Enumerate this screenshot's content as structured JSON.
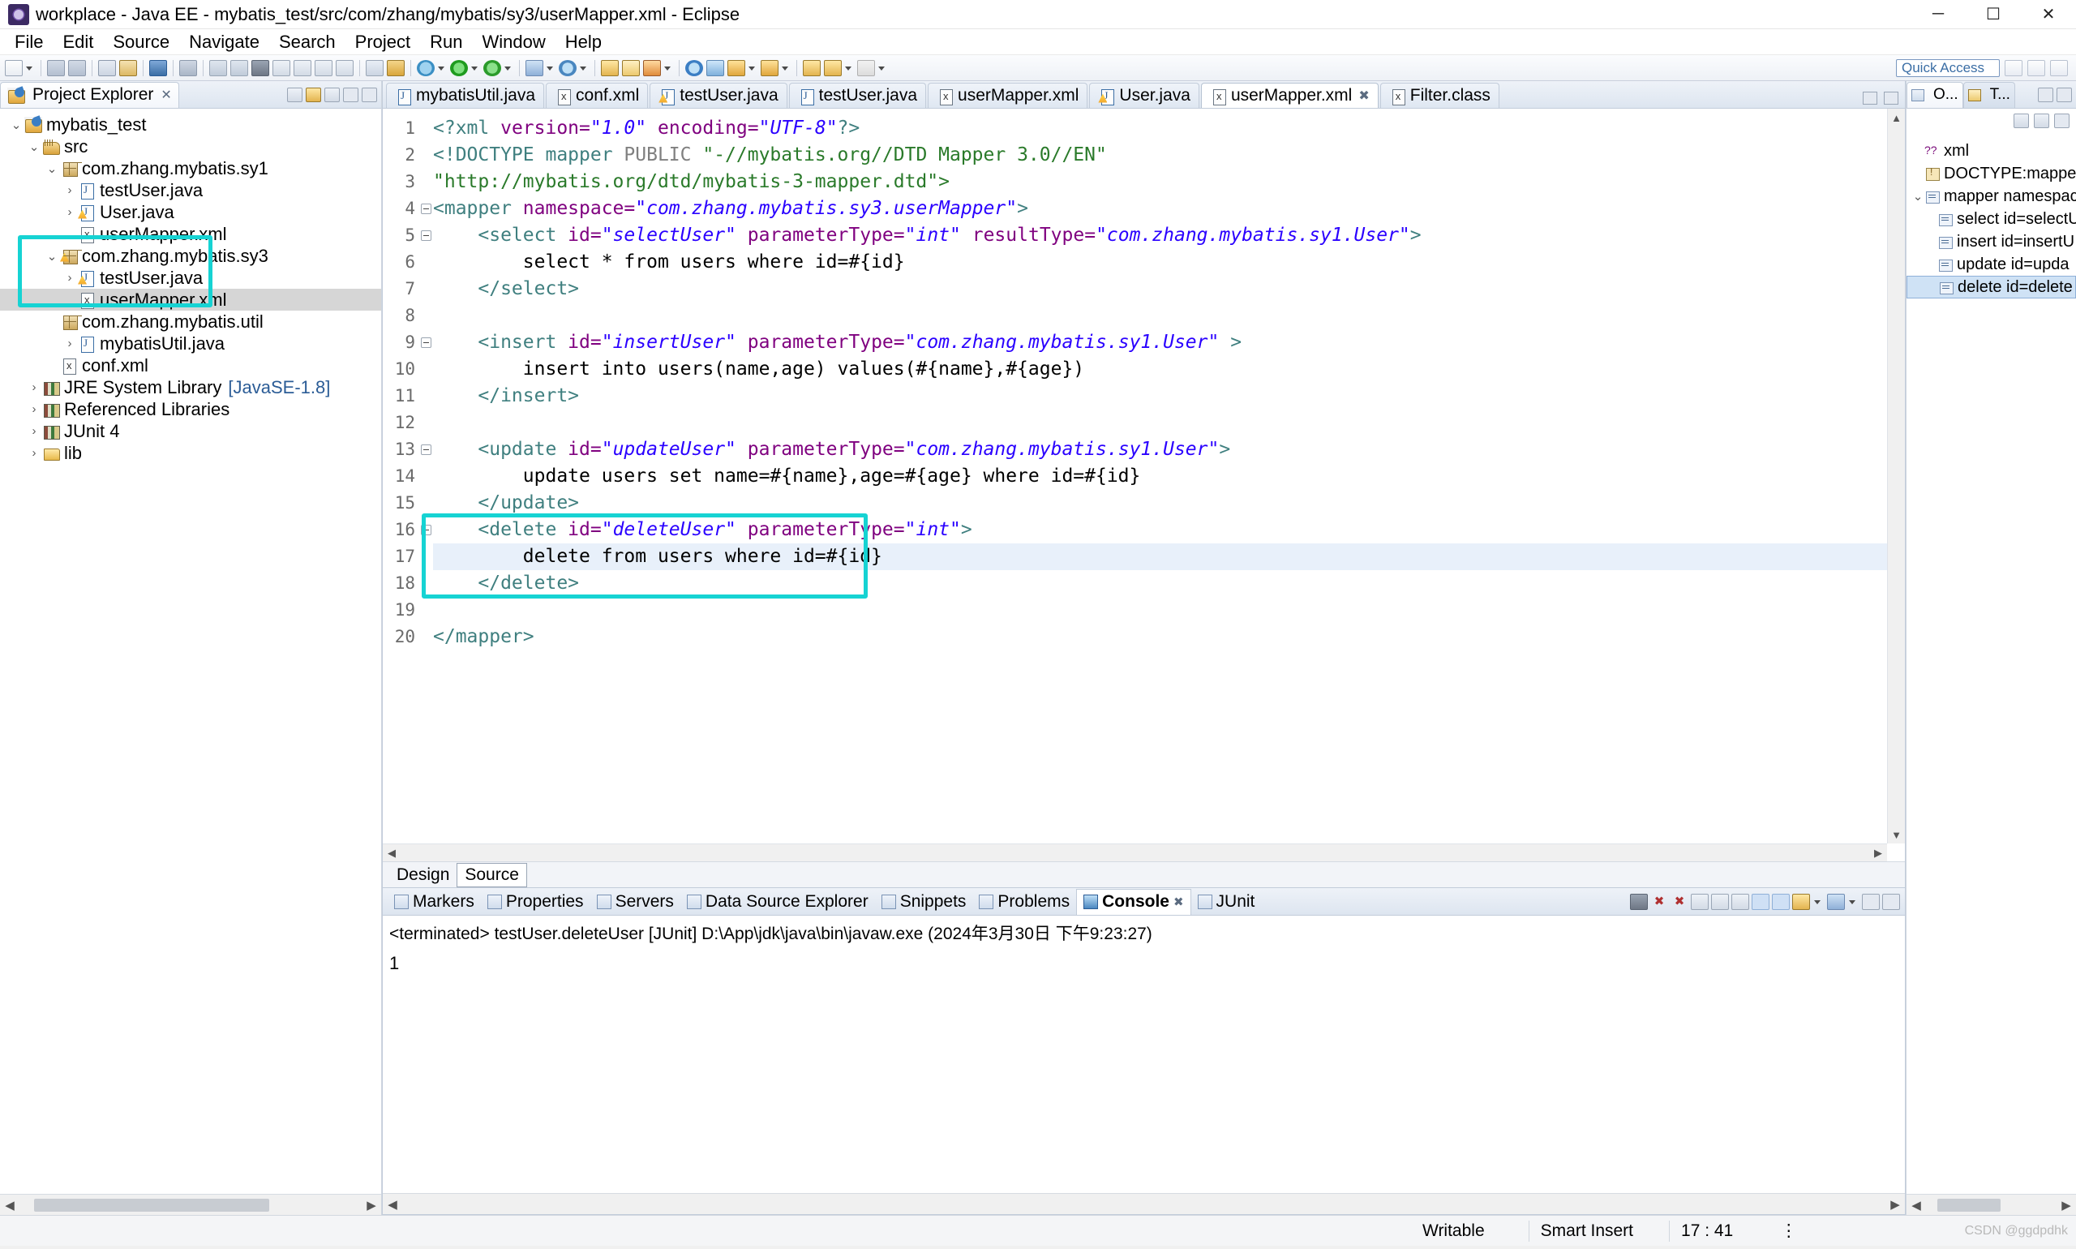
{
  "window": {
    "title": "workplace - Java EE - mybatis_test/src/com/zhang/mybatis/sy3/userMapper.xml - Eclipse",
    "minimize": "─",
    "maximize": "☐",
    "close": "✕"
  },
  "menu": [
    "File",
    "Edit",
    "Source",
    "Navigate",
    "Search",
    "Project",
    "Run",
    "Window",
    "Help"
  ],
  "toolbar": {
    "quick_access_placeholder": "Quick Access"
  },
  "explorer": {
    "tab_label": "Project Explorer",
    "tab_close": "✕",
    "items": [
      {
        "label": "mybatis_test",
        "indent": 0,
        "twisty": "⌄",
        "icon": "project-icon",
        "selected": false
      },
      {
        "label": "src",
        "indent": 1,
        "twisty": "⌄",
        "icon": "source-folder-icon",
        "selected": false
      },
      {
        "label": "com.zhang.mybatis.sy1",
        "indent": 2,
        "twisty": "⌄",
        "icon": "package-icon",
        "selected": false
      },
      {
        "label": "testUser.java",
        "indent": 3,
        "twisty": "›",
        "icon": "java-file-icon",
        "selected": false
      },
      {
        "label": "User.java",
        "indent": 3,
        "twisty": "›",
        "icon": "java-file-warn-icon",
        "selected": false
      },
      {
        "label": "userMapper.xml",
        "indent": 3,
        "twisty": "",
        "icon": "xml-file-icon",
        "selected": false
      },
      {
        "label": "com.zhang.mybatis.sy3",
        "indent": 2,
        "twisty": "⌄",
        "icon": "package-warn-icon",
        "selected": false
      },
      {
        "label": "testUser.java",
        "indent": 3,
        "twisty": "›",
        "icon": "java-file-warn-icon",
        "selected": false
      },
      {
        "label": "userMapper.xml",
        "indent": 3,
        "twisty": "",
        "icon": "xml-file-icon",
        "selected": true
      },
      {
        "label": "com.zhang.mybatis.util",
        "indent": 2,
        "twisty": "",
        "icon": "package-icon",
        "selected": false
      },
      {
        "label": "mybatisUtil.java",
        "indent": 3,
        "twisty": "›",
        "icon": "java-file-icon",
        "selected": false
      },
      {
        "label": "conf.xml",
        "indent": 2,
        "twisty": "",
        "icon": "xml-file-icon",
        "selected": false
      },
      {
        "label": "JRE System Library",
        "label_suffix": "[JavaSE-1.8]",
        "indent": 1,
        "twisty": "›",
        "icon": "library-icon",
        "selected": false
      },
      {
        "label": "Referenced Libraries",
        "indent": 1,
        "twisty": "›",
        "icon": "library-icon",
        "selected": false
      },
      {
        "label": "JUnit 4",
        "indent": 1,
        "twisty": "›",
        "icon": "library-icon",
        "selected": false
      },
      {
        "label": "lib",
        "indent": 1,
        "twisty": "›",
        "icon": "folder-icon",
        "selected": false
      }
    ]
  },
  "editor": {
    "tabs": [
      {
        "label": "mybatisUtil.java",
        "icon": "java-file-icon",
        "active": false,
        "closable": false
      },
      {
        "label": "conf.xml",
        "icon": "xml-file-icon",
        "active": false,
        "closable": false
      },
      {
        "label": "testUser.java",
        "icon": "java-file-warn-icon",
        "active": false,
        "closable": false
      },
      {
        "label": "testUser.java",
        "icon": "java-file-icon",
        "active": false,
        "closable": false
      },
      {
        "label": "userMapper.xml",
        "icon": "xml-file-icon",
        "active": false,
        "closable": false
      },
      {
        "label": "User.java",
        "icon": "java-file-warn-icon",
        "active": false,
        "closable": false
      },
      {
        "label": "userMapper.xml",
        "icon": "xml-file-icon",
        "active": true,
        "closable": true
      },
      {
        "label": "Filter.class",
        "icon": "class-file-icon",
        "active": false,
        "closable": false
      }
    ],
    "tab_close_glyph": "✖",
    "design_source_tabs": [
      {
        "label": "Design",
        "active": false
      },
      {
        "label": "Source",
        "active": true
      }
    ],
    "lines": [
      {
        "n": 1,
        "fold": false,
        "highlighted": false,
        "segments": [
          {
            "t": "<?xml ",
            "c": "tag"
          },
          {
            "t": "version=",
            "c": "attr"
          },
          {
            "t": "\"1.0\"",
            "c": "str"
          },
          {
            "t": " ",
            "c": "txt"
          },
          {
            "t": "encoding=",
            "c": "attr"
          },
          {
            "t": "\"UTF-8\"",
            "c": "str"
          },
          {
            "t": "?>",
            "c": "tag"
          }
        ]
      },
      {
        "n": 2,
        "fold": false,
        "highlighted": false,
        "segments": [
          {
            "t": "<!DOCTYPE mapper ",
            "c": "tag"
          },
          {
            "t": "PUBLIC ",
            "c": "plain"
          },
          {
            "t": "\"-//mybatis.org//DTD Mapper 3.0//EN\"",
            "c": "dtdstr"
          }
        ]
      },
      {
        "n": 3,
        "fold": false,
        "highlighted": false,
        "segments": [
          {
            "t": "\"http://mybatis.org/dtd/mybatis-3-mapper.dtd\">",
            "c": "dtdstr"
          }
        ]
      },
      {
        "n": 4,
        "fold": true,
        "highlighted": false,
        "segments": [
          {
            "t": "<mapper ",
            "c": "tag"
          },
          {
            "t": "namespace=",
            "c": "attr"
          },
          {
            "t": "\"com.zhang.mybatis.sy3.userMapper\"",
            "c": "str"
          },
          {
            "t": ">",
            "c": "tag"
          }
        ]
      },
      {
        "n": 5,
        "fold": true,
        "highlighted": false,
        "segments": [
          {
            "t": "    <select ",
            "c": "tag"
          },
          {
            "t": "id=",
            "c": "attr"
          },
          {
            "t": "\"selectUser\"",
            "c": "str"
          },
          {
            "t": " ",
            "c": "txt"
          },
          {
            "t": "parameterType=",
            "c": "attr"
          },
          {
            "t": "\"int\"",
            "c": "str"
          },
          {
            "t": " ",
            "c": "txt"
          },
          {
            "t": "resultType=",
            "c": "attr"
          },
          {
            "t": "\"com.zhang.mybatis.sy1.User\"",
            "c": "str"
          },
          {
            "t": ">",
            "c": "tag"
          }
        ]
      },
      {
        "n": 6,
        "fold": false,
        "highlighted": false,
        "segments": [
          {
            "t": "        select * from users where id=#{id}",
            "c": "txt"
          }
        ]
      },
      {
        "n": 7,
        "fold": false,
        "highlighted": false,
        "segments": [
          {
            "t": "    </select>",
            "c": "tag"
          }
        ]
      },
      {
        "n": 8,
        "fold": false,
        "highlighted": false,
        "segments": [
          {
            "t": "",
            "c": "txt"
          }
        ]
      },
      {
        "n": 9,
        "fold": true,
        "highlighted": false,
        "segments": [
          {
            "t": "    <insert ",
            "c": "tag"
          },
          {
            "t": "id=",
            "c": "attr"
          },
          {
            "t": "\"insertUser\"",
            "c": "str"
          },
          {
            "t": " ",
            "c": "txt"
          },
          {
            "t": "parameterType=",
            "c": "attr"
          },
          {
            "t": "\"com.zhang.mybatis.sy1.User\"",
            "c": "str"
          },
          {
            "t": " >",
            "c": "tag"
          }
        ]
      },
      {
        "n": 10,
        "fold": false,
        "highlighted": false,
        "segments": [
          {
            "t": "        insert into users(name,age) values(#{name},#{age})",
            "c": "txt"
          }
        ]
      },
      {
        "n": 11,
        "fold": false,
        "highlighted": false,
        "segments": [
          {
            "t": "    </insert>",
            "c": "tag"
          }
        ]
      },
      {
        "n": 12,
        "fold": false,
        "highlighted": false,
        "segments": [
          {
            "t": "",
            "c": "txt"
          }
        ]
      },
      {
        "n": 13,
        "fold": true,
        "highlighted": false,
        "segments": [
          {
            "t": "    <update ",
            "c": "tag"
          },
          {
            "t": "id=",
            "c": "attr"
          },
          {
            "t": "\"updateUser\"",
            "c": "str"
          },
          {
            "t": " ",
            "c": "txt"
          },
          {
            "t": "parameterType=",
            "c": "attr"
          },
          {
            "t": "\"com.zhang.mybatis.sy1.User\"",
            "c": "str"
          },
          {
            "t": ">",
            "c": "tag"
          }
        ]
      },
      {
        "n": 14,
        "fold": false,
        "highlighted": false,
        "segments": [
          {
            "t": "        update users set name=#{name},age=#{age} where id=#{id}",
            "c": "txt"
          }
        ]
      },
      {
        "n": 15,
        "fold": false,
        "highlighted": false,
        "segments": [
          {
            "t": "    </update>",
            "c": "tag"
          }
        ]
      },
      {
        "n": 16,
        "fold": true,
        "highlighted": false,
        "segments": [
          {
            "t": "    <delete ",
            "c": "tag"
          },
          {
            "t": "id=",
            "c": "attr"
          },
          {
            "t": "\"deleteUser\"",
            "c": "str"
          },
          {
            "t": " ",
            "c": "txt"
          },
          {
            "t": "parameterType=",
            "c": "attr"
          },
          {
            "t": "\"int\"",
            "c": "str"
          },
          {
            "t": ">",
            "c": "tag"
          }
        ]
      },
      {
        "n": 17,
        "fold": false,
        "highlighted": true,
        "segments": [
          {
            "t": "        delete from users where id=#{id}",
            "c": "txt"
          }
        ]
      },
      {
        "n": 18,
        "fold": false,
        "highlighted": false,
        "segments": [
          {
            "t": "    </delete>",
            "c": "tag"
          }
        ]
      },
      {
        "n": 19,
        "fold": false,
        "highlighted": false,
        "segments": [
          {
            "t": "",
            "c": "txt"
          }
        ]
      },
      {
        "n": 20,
        "fold": false,
        "highlighted": false,
        "segments": [
          {
            "t": "</mapper>",
            "c": "tag"
          }
        ]
      }
    ]
  },
  "outline": {
    "tab_label": "O...",
    "tab_label2": "T...",
    "items": [
      {
        "label": "xml",
        "icon": "processing-instruction-icon",
        "indent": 0,
        "twisty": "",
        "selected": false
      },
      {
        "label": "DOCTYPE:mapper",
        "icon": "doctype-icon",
        "indent": 0,
        "twisty": "",
        "selected": false
      },
      {
        "label": "mapper namespac",
        "icon": "element-icon",
        "indent": 0,
        "twisty": "⌄",
        "selected": false
      },
      {
        "label": "select id=selectU",
        "icon": "element-icon",
        "indent": 1,
        "twisty": "",
        "selected": false
      },
      {
        "label": "insert id=insertU",
        "icon": "element-icon",
        "indent": 1,
        "twisty": "",
        "selected": false
      },
      {
        "label": "update id=upda",
        "icon": "element-icon",
        "indent": 1,
        "twisty": "",
        "selected": false
      },
      {
        "label": "delete id=delete",
        "icon": "element-icon",
        "indent": 1,
        "twisty": "",
        "selected": true
      }
    ]
  },
  "bottom_panel": {
    "tabs": [
      {
        "label": "Markers",
        "icon": "markers-icon",
        "active": false
      },
      {
        "label": "Properties",
        "icon": "properties-icon",
        "active": false
      },
      {
        "label": "Servers",
        "icon": "servers-icon",
        "active": false
      },
      {
        "label": "Data Source Explorer",
        "icon": "datasource-icon",
        "active": false
      },
      {
        "label": "Snippets",
        "icon": "snippets-icon",
        "active": false
      },
      {
        "label": "Problems",
        "icon": "problems-icon",
        "active": false
      },
      {
        "label": "Console",
        "icon": "console-icon",
        "active": true
      },
      {
        "label": "JUnit",
        "icon": "junit-icon",
        "active": false
      }
    ],
    "tab_close_glyph": "✖",
    "console_header": "<terminated> testUser.deleteUser [JUnit] D:\\App\\jdk\\java\\bin\\javaw.exe (2024年3月30日 下午9:23:27)",
    "console_output": "1"
  },
  "statusbar": {
    "writable": "Writable",
    "insert_mode": "Smart Insert",
    "cursor_position": "17 : 41",
    "watermark": "CSDN @ggdpdhk"
  },
  "colors": {
    "highlight_box": "#16d3d3",
    "selection": "#d6d6d6",
    "line_highlight": "#e8f0fa",
    "tag": "#3f7f7f",
    "attribute": "#7f007f",
    "string": "#2a00ff",
    "dtd_string": "#2a7a2a"
  }
}
